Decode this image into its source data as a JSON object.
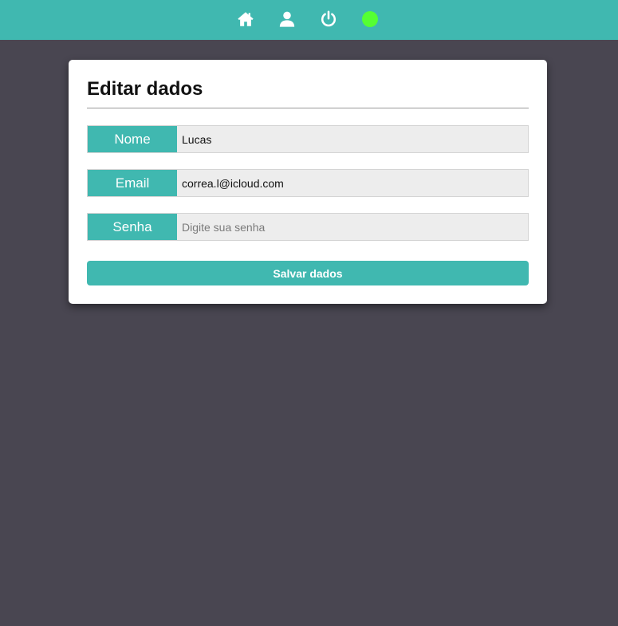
{
  "nav": {
    "icons": [
      "home-icon",
      "user-icon",
      "power-icon"
    ],
    "status_color": "#55ff33",
    "bar_color": "#40b8b0"
  },
  "form": {
    "title": "Editar dados",
    "fields": [
      {
        "label": "Nome",
        "value": "Lucas",
        "placeholder": ""
      },
      {
        "label": "Email",
        "value": "correa.l@icloud.com",
        "placeholder": ""
      },
      {
        "label": "Senha",
        "value": "",
        "placeholder": "Digite sua senha"
      }
    ],
    "submit_label": "Salvar dados"
  }
}
